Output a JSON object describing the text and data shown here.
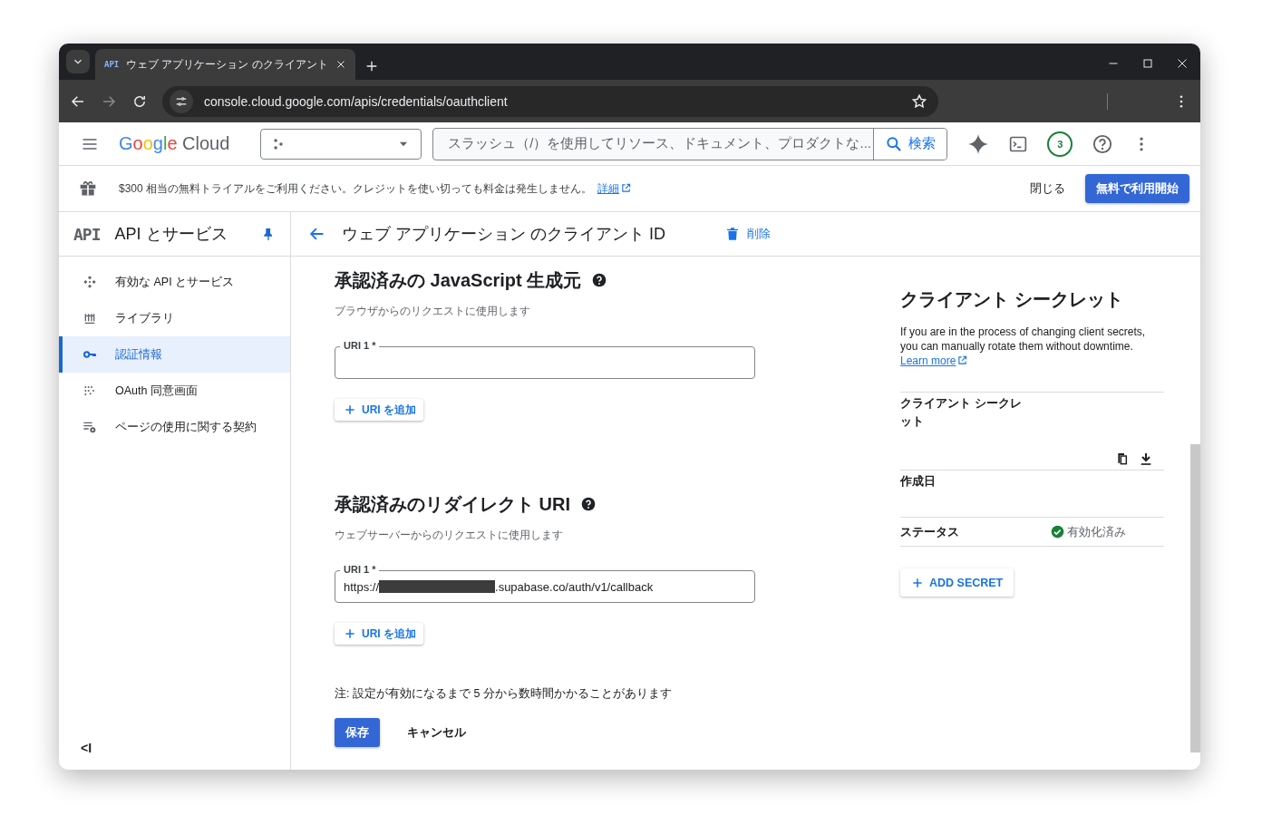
{
  "browser": {
    "tab_logo": "API",
    "tab_title": "ウェブ アプリケーション のクライアント",
    "url": "console.cloud.google.com/apis/credentials/oauthclient"
  },
  "header": {
    "logo_word": "Google",
    "logo_product": "Cloud",
    "search_placeholder": "スラッシュ（/）を使用してリソース、ドキュメント、プロダクトな...",
    "search_button": "検索",
    "notification_count": "3"
  },
  "banner": {
    "text": "$300 相当の無料トライアルをご利用ください。クレジットを使い切っても料金は発生しません。",
    "link": "詳細",
    "dismiss": "閉じる",
    "cta": "無料で利用開始"
  },
  "sidebar": {
    "logo": "API",
    "title": "API とサービス",
    "pinned": true,
    "collapse": "<I",
    "items": [
      {
        "label": "有効な API とサービス",
        "selected": false
      },
      {
        "label": "ライブラリ",
        "selected": false
      },
      {
        "label": "認証情報",
        "selected": true
      },
      {
        "label": "OAuth 同意画面",
        "selected": false
      },
      {
        "label": "ページの使用に関する契約",
        "selected": false
      }
    ]
  },
  "page": {
    "title": "ウェブ アプリケーション のクライアント ID",
    "delete": "削除"
  },
  "sections": [
    {
      "title": "承認済みの JavaScript 生成元",
      "subtitle": "ブラウザからのリクエストに使用します",
      "fields": [
        {
          "label": "URI 1 *"
        }
      ],
      "add_button": "URI を追加"
    },
    {
      "title": "承認済みのリダイレクト URI",
      "subtitle": "ウェブサーバーからのリクエストに使用します",
      "fields": [
        {
          "label": "URI 1 *",
          "value_prefix": "https://",
          "redacted": true,
          "value_suffix": ".supabase.co/auth/v1/callback"
        }
      ],
      "add_button": "URI を追加"
    }
  ],
  "note": "注: 設定が有効になるまで 5 分から数時間かかることがあります",
  "actions": {
    "save": "保存",
    "cancel": "キャンセル"
  },
  "secret": {
    "title": "クライアント シークレット",
    "description": "If you are in the process of changing client secrets, you can manually rotate them without downtime.",
    "learn_more": "Learn more",
    "rows": [
      {
        "kind": "secret",
        "label": "クライアント シークレット"
      },
      {
        "kind": "plain",
        "label": "作成日"
      },
      {
        "kind": "status",
        "label": "ステータス",
        "value": "有効化済み"
      }
    ],
    "add_button": "ADD SECRET"
  }
}
